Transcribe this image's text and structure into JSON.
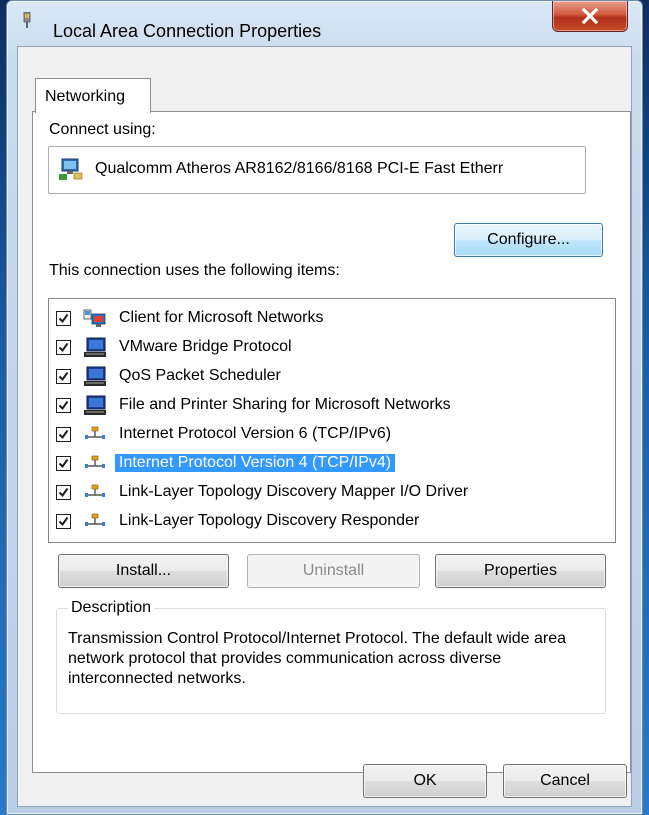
{
  "window": {
    "title": "Local Area Connection Properties"
  },
  "tabs": [
    {
      "label": "Networking"
    }
  ],
  "connect_using": {
    "label": "Connect using:",
    "adapter": "Qualcomm Atheros AR8162/8166/8168 PCI-E Fast Etherr"
  },
  "buttons": {
    "configure": "Configure...",
    "install": "Install...",
    "uninstall": "Uninstall",
    "properties": "Properties",
    "ok": "OK",
    "cancel": "Cancel"
  },
  "items_label": "This connection uses the following items:",
  "items": [
    {
      "label": "Client for Microsoft Networks",
      "checked": true,
      "icon": "client-network-icon"
    },
    {
      "label": "VMware Bridge Protocol",
      "checked": true,
      "icon": "computer-protocol-icon"
    },
    {
      "label": "QoS Packet Scheduler",
      "checked": true,
      "icon": "computer-protocol-icon"
    },
    {
      "label": "File and Printer Sharing for Microsoft Networks",
      "checked": true,
      "icon": "computer-protocol-icon"
    },
    {
      "label": "Internet Protocol Version 6 (TCP/IPv6)",
      "checked": true,
      "icon": "network-protocol-icon"
    },
    {
      "label": "Internet Protocol Version 4 (TCP/IPv4)",
      "checked": true,
      "icon": "network-protocol-icon",
      "selected": true
    },
    {
      "label": "Link-Layer Topology Discovery Mapper I/O Driver",
      "checked": true,
      "icon": "network-protocol-icon"
    },
    {
      "label": "Link-Layer Topology Discovery Responder",
      "checked": true,
      "icon": "network-protocol-icon"
    }
  ],
  "description": {
    "title": "Description",
    "text": "Transmission Control Protocol/Internet Protocol. The default wide area network protocol that provides communication across diverse interconnected networks."
  },
  "colors": {
    "selection": "#3399ff",
    "window_frame": "#c9dbef",
    "close_button": "#c64a2a"
  }
}
